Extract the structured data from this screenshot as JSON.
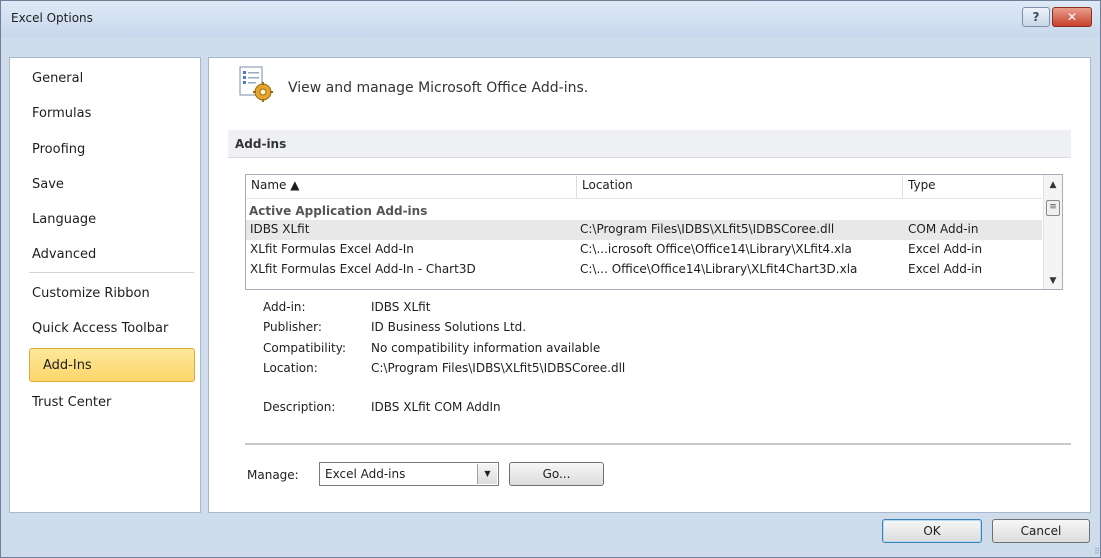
{
  "window": {
    "title": "Excel Options",
    "help_label": "?",
    "close_label": "✕"
  },
  "sidebar": {
    "items": [
      {
        "label": "General"
      },
      {
        "label": "Formulas"
      },
      {
        "label": "Proofing"
      },
      {
        "label": "Save"
      },
      {
        "label": "Language"
      },
      {
        "label": "Advanced"
      },
      {
        "label": "Customize Ribbon"
      },
      {
        "label": "Quick Access Toolbar"
      },
      {
        "label": "Add-Ins",
        "selected": true
      },
      {
        "label": "Trust Center"
      }
    ]
  },
  "header": {
    "title": "View and manage Microsoft Office Add-ins.",
    "icon": "add-ins-gear-icon"
  },
  "section": {
    "title": "Add-ins"
  },
  "table": {
    "columns": [
      "Name ▲",
      "Location",
      "Type"
    ],
    "group": "Active Application Add-ins",
    "rows": [
      {
        "name": "IDBS XLfit",
        "location": "C:\\Program Files\\IDBS\\XLfit5\\IDBSCoree.dll",
        "type": "COM Add-in",
        "selected": true
      },
      {
        "name": "XLfit Formulas Excel Add-In",
        "location": "C:\\...icrosoft Office\\Office14\\Library\\XLfit4.xla",
        "type": "Excel Add-in"
      },
      {
        "name": "XLfit Formulas Excel Add-In - Chart3D",
        "location": "C:\\... Office\\Office14\\Library\\XLfit4Chart3D.xla",
        "type": "Excel Add-in"
      }
    ],
    "scroll_up": "▲",
    "scroll_thumb": "≡",
    "scroll_down": "▼"
  },
  "details": {
    "addin_label": "Add-in:",
    "addin_value": "IDBS XLfit",
    "publisher_label": "Publisher:",
    "publisher_value": "ID Business Solutions Ltd.",
    "compat_label": "Compatibility:",
    "compat_value": "No compatibility information available",
    "location_label": "Location:",
    "location_value": "C:\\Program Files\\IDBS\\XLfit5\\IDBSCoree.dll",
    "description_label": "Description:",
    "description_value": "IDBS XLfit COM AddIn"
  },
  "manage": {
    "label": "Manage:",
    "selected": "Excel Add-ins",
    "arrow": "▼",
    "go_label": "Go..."
  },
  "footer": {
    "ok_label": "OK",
    "cancel_label": "Cancel"
  }
}
